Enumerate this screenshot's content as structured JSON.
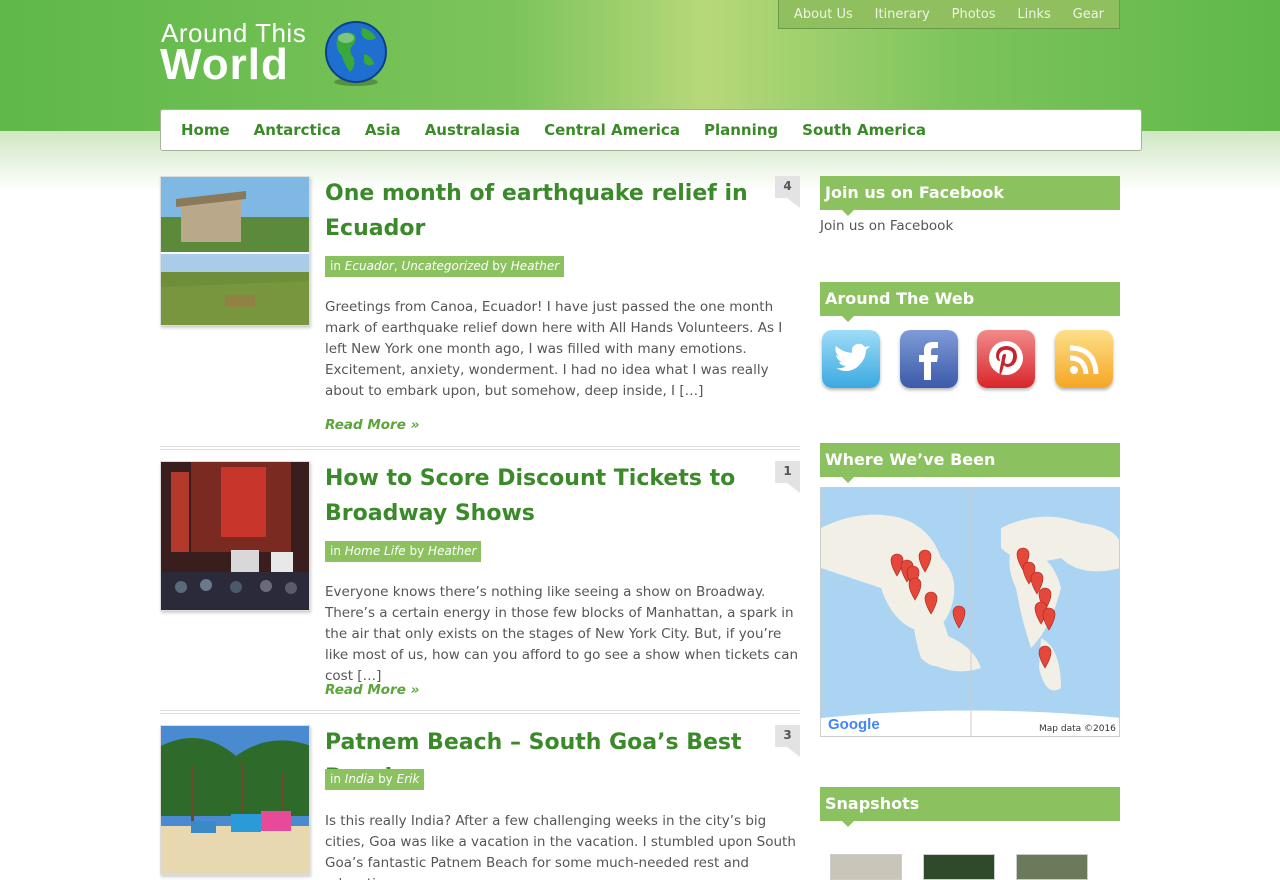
{
  "site": {
    "logo_line1": "Around This",
    "logo_line2": "World"
  },
  "top_nav": [
    "About Us",
    "Itinerary",
    "Photos",
    "Links",
    "Gear"
  ],
  "main_nav": [
    "Home",
    "Antarctica",
    "Asia",
    "Australasia",
    "Central America",
    "Planning",
    "South America"
  ],
  "posts": [
    {
      "title": "One month of earthquake relief in Ecuador",
      "meta_in": "in",
      "categories": [
        "Ecuador",
        "Uncategorized"
      ],
      "meta_by": "by",
      "author": "Heather",
      "excerpt": "Greetings from Canoa, Ecuador! I have just passed the one month mark of earthquake relief down here with All Hands Volunteers. As I left New York one month ago, I was filled with many emotions. Excitement, anxiety, wonderment. I had no idea what I was really about to embark upon, but somehow, deep inside, I […]",
      "read_more": "Read More »",
      "comments": "4"
    },
    {
      "title": "How to Score Discount Tickets to Broadway Shows",
      "meta_in": "in",
      "categories": [
        "Home Life"
      ],
      "meta_by": "by",
      "author": "Heather",
      "excerpt": "Everyone knows there’s nothing like seeing a show on Broadway. There’s a certain energy in those few blocks of Manhattan, a spark in the air that only exists on the stages of New York City. But, if you’re like most of us, how can you afford to go see a show when tickets can cost […]",
      "read_more": "Read More »",
      "comments": "1"
    },
    {
      "title": "Patnem Beach – South Goa’s Best Beach",
      "meta_in": "in",
      "categories": [
        "India"
      ],
      "meta_by": "by",
      "author": "Erik",
      "excerpt": "Is this really India? After a few challenging weeks in the city’s big cities, Goa was like a vacation in the vacation. I stumbled upon South Goa’s fantastic Patnem Beach for some much-needed rest and relaxation.",
      "comments": "3"
    }
  ],
  "sidebar": {
    "facebook_heading": "Join us on Facebook",
    "facebook_link": "Join us on Facebook",
    "web_heading": "Around The Web",
    "social_icons": [
      "twitter-icon",
      "facebook-icon",
      "pinterest-icon",
      "rss-icon"
    ],
    "map_heading": "Where We’ve Been",
    "map_logo": "Google",
    "map_data": "Map data ©2016",
    "snapshots_heading": "Snapshots"
  },
  "colors": {
    "accent_green": "#3b8a2a",
    "widget_green": "#8cc15f"
  }
}
